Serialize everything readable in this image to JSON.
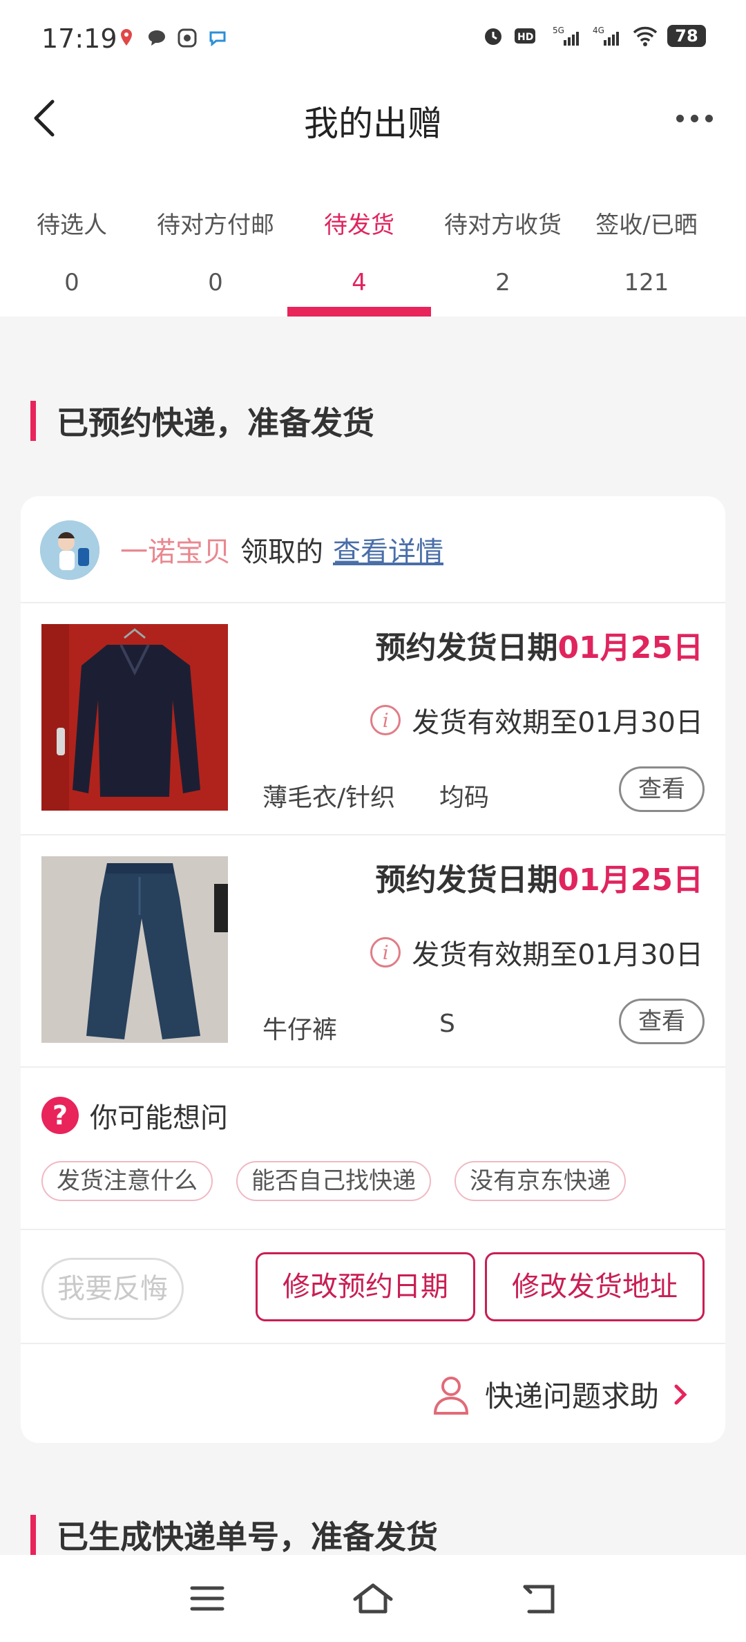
{
  "status_bar": {
    "time": "17:19",
    "battery": "78"
  },
  "header": {
    "title": "我的出赠"
  },
  "tabs": [
    {
      "label": "待选人",
      "count": "0"
    },
    {
      "label": "待对方付邮",
      "count": "0"
    },
    {
      "label": "待发货",
      "count": "4"
    },
    {
      "label": "待对方收货",
      "count": "2"
    },
    {
      "label": "签收/已晒",
      "count": "121"
    }
  ],
  "section1": {
    "title": "已预约快递，准备发货"
  },
  "receiver": {
    "name": "一诺宝贝",
    "verb": "领取的",
    "link": "查看详情"
  },
  "items": [
    {
      "date_label": "预约发货日期",
      "date_value": "01月25日",
      "deadline": "发货有效期至01月30日",
      "category": "薄毛衣/针织",
      "size": "均码",
      "view": "查看"
    },
    {
      "date_label": "预约发货日期",
      "date_value": "01月25日",
      "deadline": "发货有效期至01月30日",
      "category": "牛仔裤",
      "size": "S",
      "view": "查看"
    }
  ],
  "faq": {
    "title": "你可能想问",
    "chips": [
      "发货注意什么",
      "能否自己找快递",
      "没有京东快递"
    ]
  },
  "actions": {
    "regret": "我要反悔",
    "modify_date": "修改预约日期",
    "modify_address": "修改发货地址"
  },
  "help": {
    "label": "快递问题求助"
  },
  "section2": {
    "title": "已生成快递单号，准备发货"
  },
  "colors": {
    "accent": "#e8245a",
    "name_pink": "#e9878f",
    "link_blue": "#4a6ea8"
  }
}
